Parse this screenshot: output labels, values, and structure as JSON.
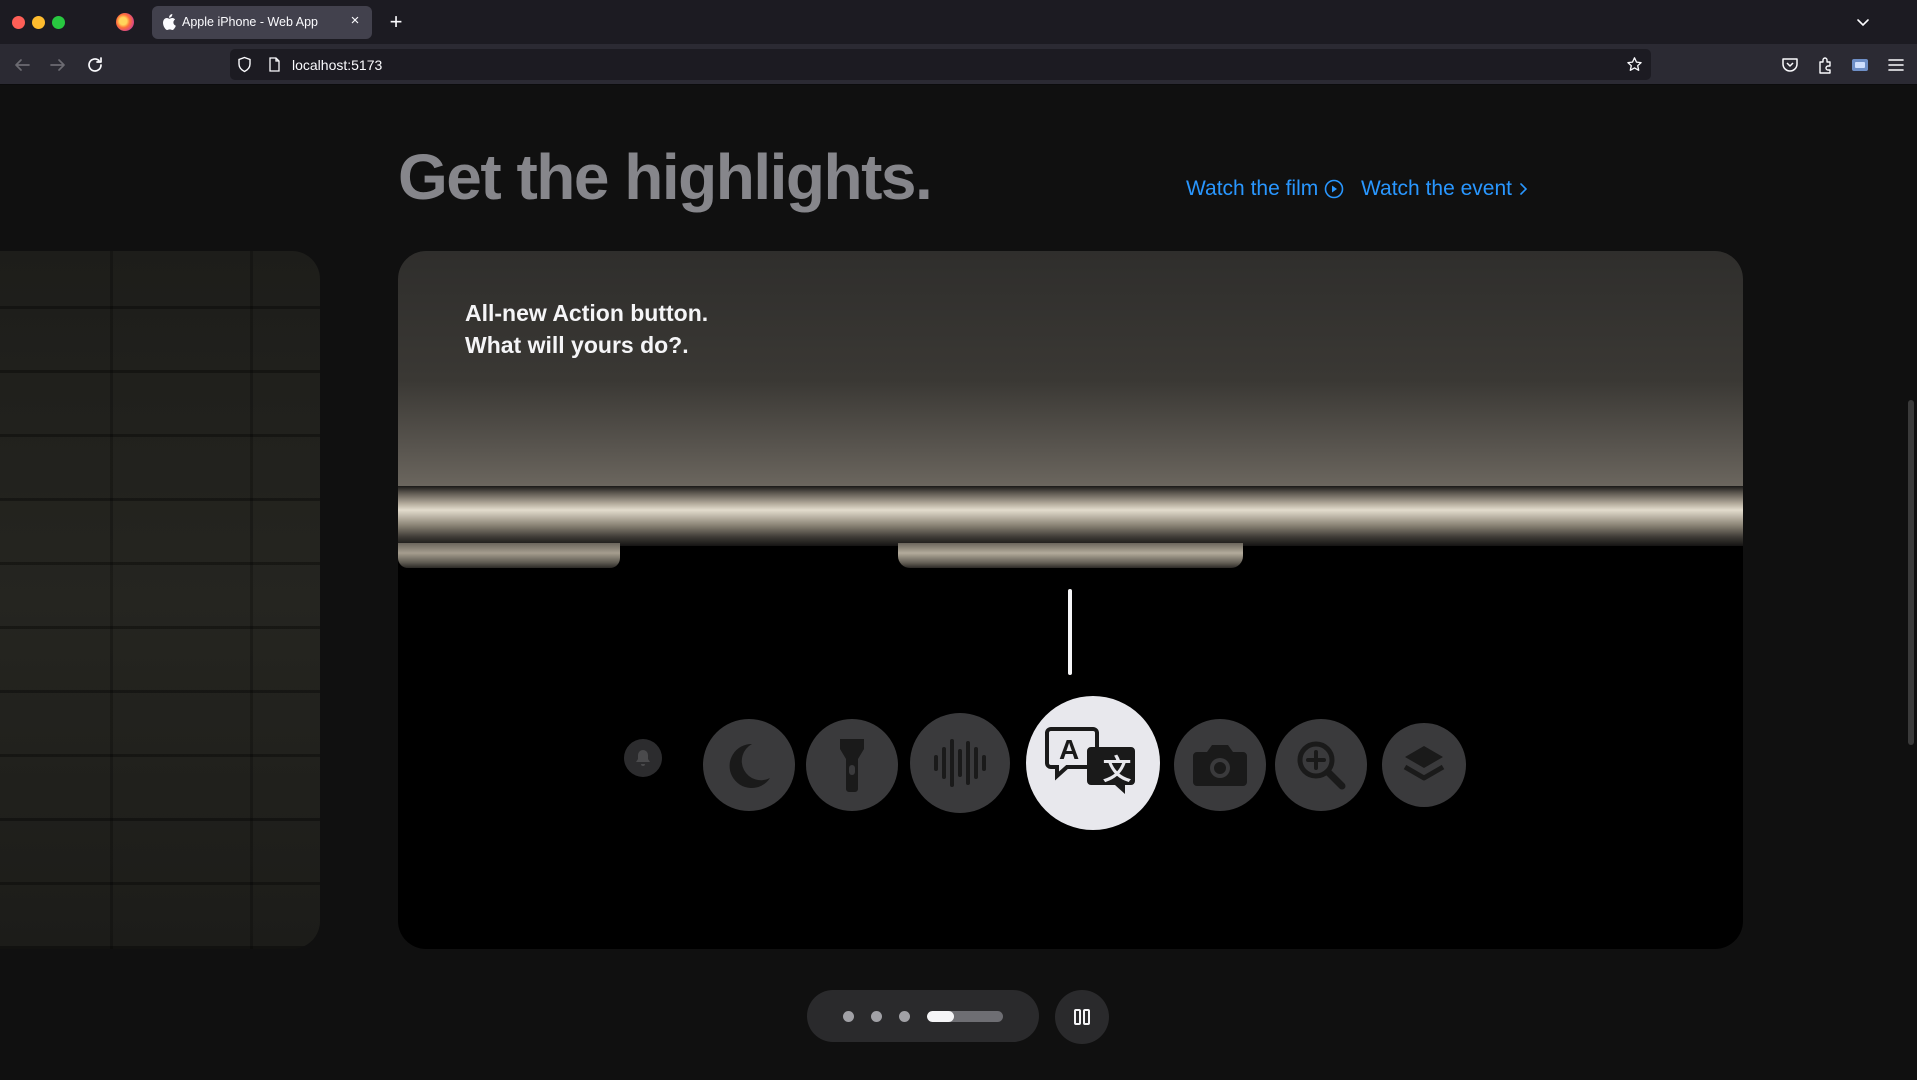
{
  "browser": {
    "tab_title": "Apple iPhone - Web App",
    "tab_close": "×",
    "new_tab": "+",
    "url": "localhost:5173"
  },
  "page": {
    "headline": "Get the highlights.",
    "links": {
      "watch_film": "Watch the film",
      "watch_event": "Watch the event"
    }
  },
  "card": {
    "title_line1": "All-new Action button.",
    "title_line2": "What will yours do?.",
    "action_icons": [
      "silent-mode-icon",
      "focus-moon-icon",
      "flashlight-icon",
      "voice-memo-icon",
      "translate-icon",
      "camera-icon",
      "magnifier-icon",
      "shortcuts-icon"
    ],
    "active_icon": "translate-icon"
  },
  "carousel": {
    "slide_count": 4,
    "active_slide": 4,
    "progress": 0.35
  },
  "colors": {
    "link": "#2997ff",
    "headline": "#86868b",
    "background": "#101010"
  }
}
